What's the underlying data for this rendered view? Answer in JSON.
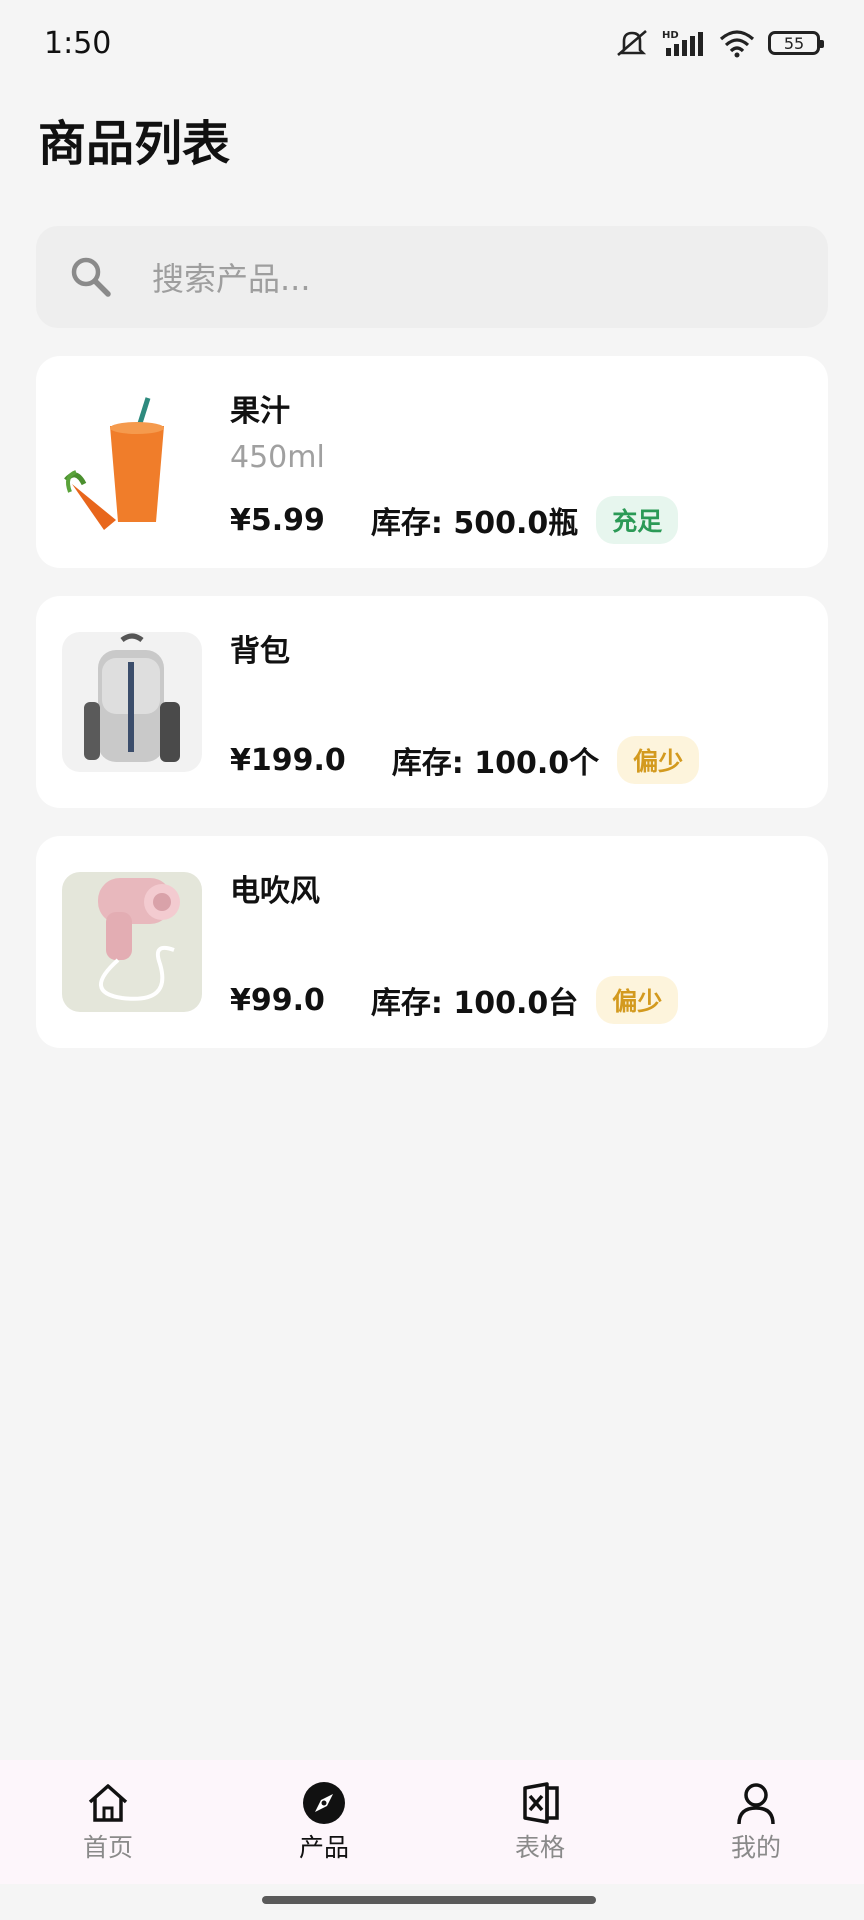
{
  "status_bar": {
    "time": "1:50",
    "battery": "55",
    "icons": [
      "mute-icon",
      "hd-signal-icon",
      "wifi-icon",
      "battery-icon"
    ]
  },
  "header": {
    "title": "商品列表"
  },
  "search": {
    "placeholder": "搜索产品..."
  },
  "products": [
    {
      "name": "果汁",
      "spec": "450ml",
      "price": "¥5.99",
      "stock": "库存: 500.0瓶",
      "badge": "充足",
      "badge_status": "ok"
    },
    {
      "name": "背包",
      "spec": "",
      "price": "¥199.0",
      "stock": "库存: 100.0个",
      "badge": "偏少",
      "badge_status": "low"
    },
    {
      "name": "电吹风",
      "spec": "",
      "price": "¥99.0",
      "stock": "库存: 100.0台",
      "badge": "偏少",
      "badge_status": "low"
    }
  ],
  "nav": {
    "items": [
      {
        "label": "首页",
        "icon": "home-icon",
        "active": false
      },
      {
        "label": "产品",
        "icon": "compass-icon",
        "active": true
      },
      {
        "label": "表格",
        "icon": "spreadsheet-icon",
        "active": false
      },
      {
        "label": "我的",
        "icon": "person-icon",
        "active": false
      }
    ]
  },
  "colors": {
    "badge_ok_bg": "#e7f6ee",
    "badge_ok_text": "#2b9a56",
    "badge_low_bg": "#fdf4dc",
    "badge_low_text": "#d39a1f"
  }
}
